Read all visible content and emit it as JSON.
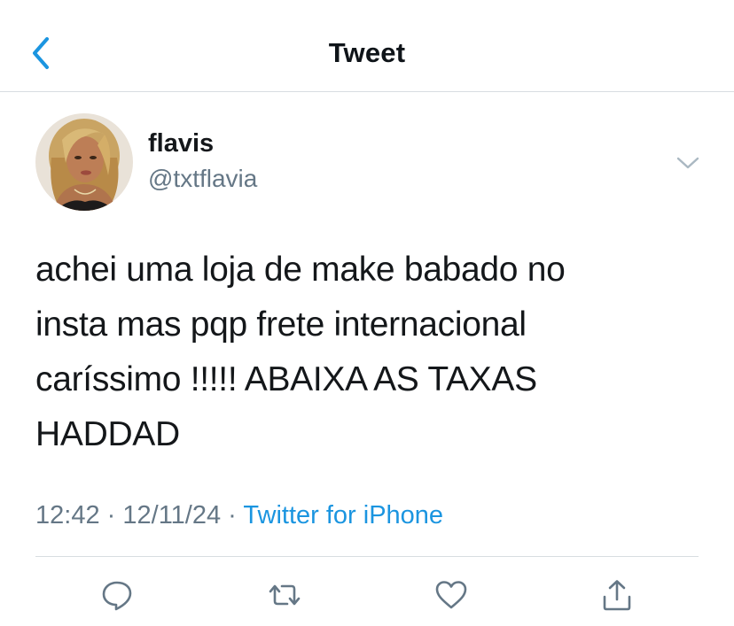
{
  "header": {
    "title": "Tweet",
    "back_icon": "chevron-left-icon"
  },
  "accent_color": "#1b95e0",
  "tweet": {
    "author": {
      "display_name": "flavis",
      "handle": "@txtflavia"
    },
    "text_lines": [
      "achei uma loja de make babado no",
      "insta mas pqp frete internacional",
      "caríssimo !!!!! ABAIXA AS TAXAS",
      "HADDAD"
    ],
    "time": "12:42",
    "date": "12/11/24",
    "separator": "·",
    "source": "Twitter for iPhone"
  },
  "actions": [
    {
      "name": "reply",
      "icon": "reply-icon"
    },
    {
      "name": "retweet",
      "icon": "retweet-icon"
    },
    {
      "name": "like",
      "icon": "heart-icon"
    },
    {
      "name": "share",
      "icon": "share-icon"
    }
  ]
}
